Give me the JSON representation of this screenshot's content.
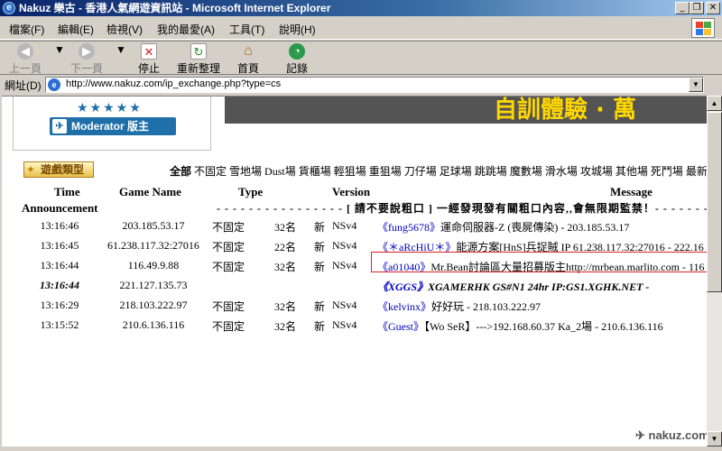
{
  "window": {
    "title": "Nakuz 樂古 - 香港人氣網遊資訊站 - Microsoft Internet Explorer",
    "icon": "ie-icon"
  },
  "menu": [
    "檔案(F)",
    "編輯(E)",
    "檢視(V)",
    "我的最愛(A)",
    "工具(T)",
    "說明(H)"
  ],
  "toolbar": {
    "back": "上一頁",
    "forward": "下一頁",
    "stop": "停止",
    "refresh": "重新整理",
    "home": "首頁",
    "history": "記錄"
  },
  "address": {
    "label": "網址(D)",
    "url": "http://www.nakuz.com/ip_exchange.php?type=cs"
  },
  "banner": {
    "moderator_label": "Moderator 版主",
    "stars": "★★★★★",
    "ad_text": "自訓體驗 · 萬"
  },
  "filters": {
    "title": "遊戲類型",
    "items": [
      "全部",
      "不固定",
      "雪地場",
      "Dust場",
      "貨櫃場",
      "輕狙場",
      "重狙場",
      "刀仔場",
      "足球場",
      "跳跳場",
      "魔數場",
      "滑水場",
      "攻城場",
      "其他場",
      "死鬥場",
      "最新"
    ]
  },
  "table": {
    "headers": {
      "time": "Time",
      "game_name": "Game Name",
      "type": "Type",
      "version": "Version",
      "message": "Message",
      "announcement": "Announcement"
    },
    "announcement": "- - - - - - - - - - - - - - - - [ 請不要說粗口 ] 一經發現發有關粗口內容,,會無限期監禁！- - - - - - - -",
    "rows": [
      {
        "time": "13:16:46",
        "ip": "203.185.53.17",
        "type": "不固定",
        "count": "32名",
        "new": "新",
        "ver": "NSv4",
        "nick": "《fung5678》",
        "msg": "運命伺服器-Z (喪屍傳染) - 203.185.53.17"
      },
      {
        "time": "13:16:45",
        "ip": "61.238.117.32:27016",
        "type": "不固定",
        "count": "22名",
        "new": "新",
        "ver": "NSv4",
        "nick": "《＊aRcHiU＊》",
        "msg": "能源方案[HnS]兵捉賊 IP 61.238.117.32:27016 - 222.16"
      },
      {
        "time": "13:16:44",
        "ip": "116.49.9.88",
        "type": "不固定",
        "count": "32名",
        "new": "新",
        "ver": "NSv4",
        "nick": "《a01040》",
        "msg": "Mr.Bean討論區大量招募版主http://mrbean.marlito.com - 116"
      },
      {
        "time": "13:16:44",
        "ip": "221.127.135.73",
        "type": "",
        "count": "",
        "new": "",
        "ver": "",
        "nick": "《XGGS》",
        "msg": "XGAMERHK GS#N1 24hr IP:GS1.XGHK.NET -",
        "emphasis": true
      },
      {
        "time": "13:16:29",
        "ip": "218.103.222.97",
        "type": "不固定",
        "count": "32名",
        "new": "新",
        "ver": "NSv4",
        "nick": "《kelvinx》",
        "msg": "好好玩 - 218.103.222.97"
      },
      {
        "time": "13:15:52",
        "ip": "210.6.136.116",
        "type": "不固定",
        "count": "32名",
        "new": "新",
        "ver": "NSv4",
        "nick": "《Guest》",
        "msg": "【Wo SeR】--->192.168.60.37 Ka_2場 - 210.6.136.116"
      }
    ]
  },
  "watermark": "✈ nakuz.com"
}
